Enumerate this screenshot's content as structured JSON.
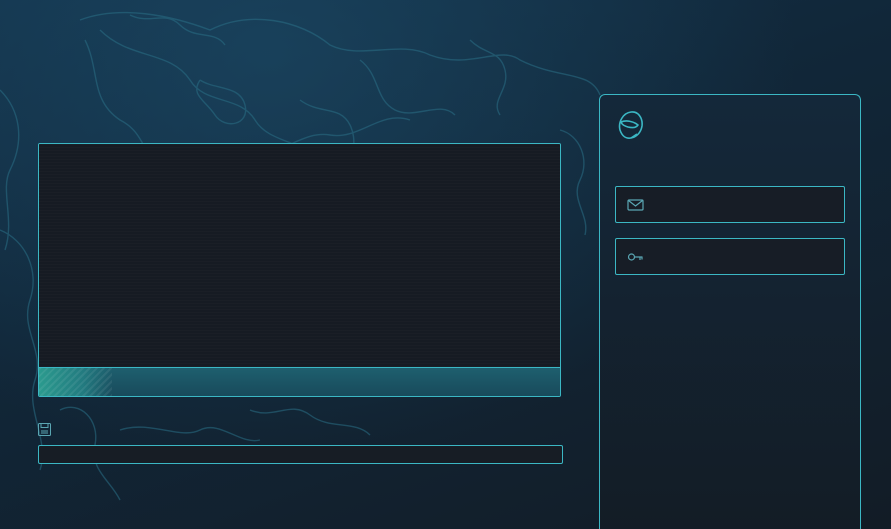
{
  "theme": {
    "accent": "#3bb7c4",
    "panel_bg": "#151b23",
    "background": "#112739"
  },
  "media": {
    "progress_fraction": 0.14
  },
  "file": {
    "icon": "save-icon",
    "path_value": ""
  },
  "login": {
    "logo_icon": "helmet-icon",
    "email": {
      "icon": "envelope-icon",
      "value": ""
    },
    "password": {
      "icon": "key-icon",
      "value": ""
    }
  }
}
